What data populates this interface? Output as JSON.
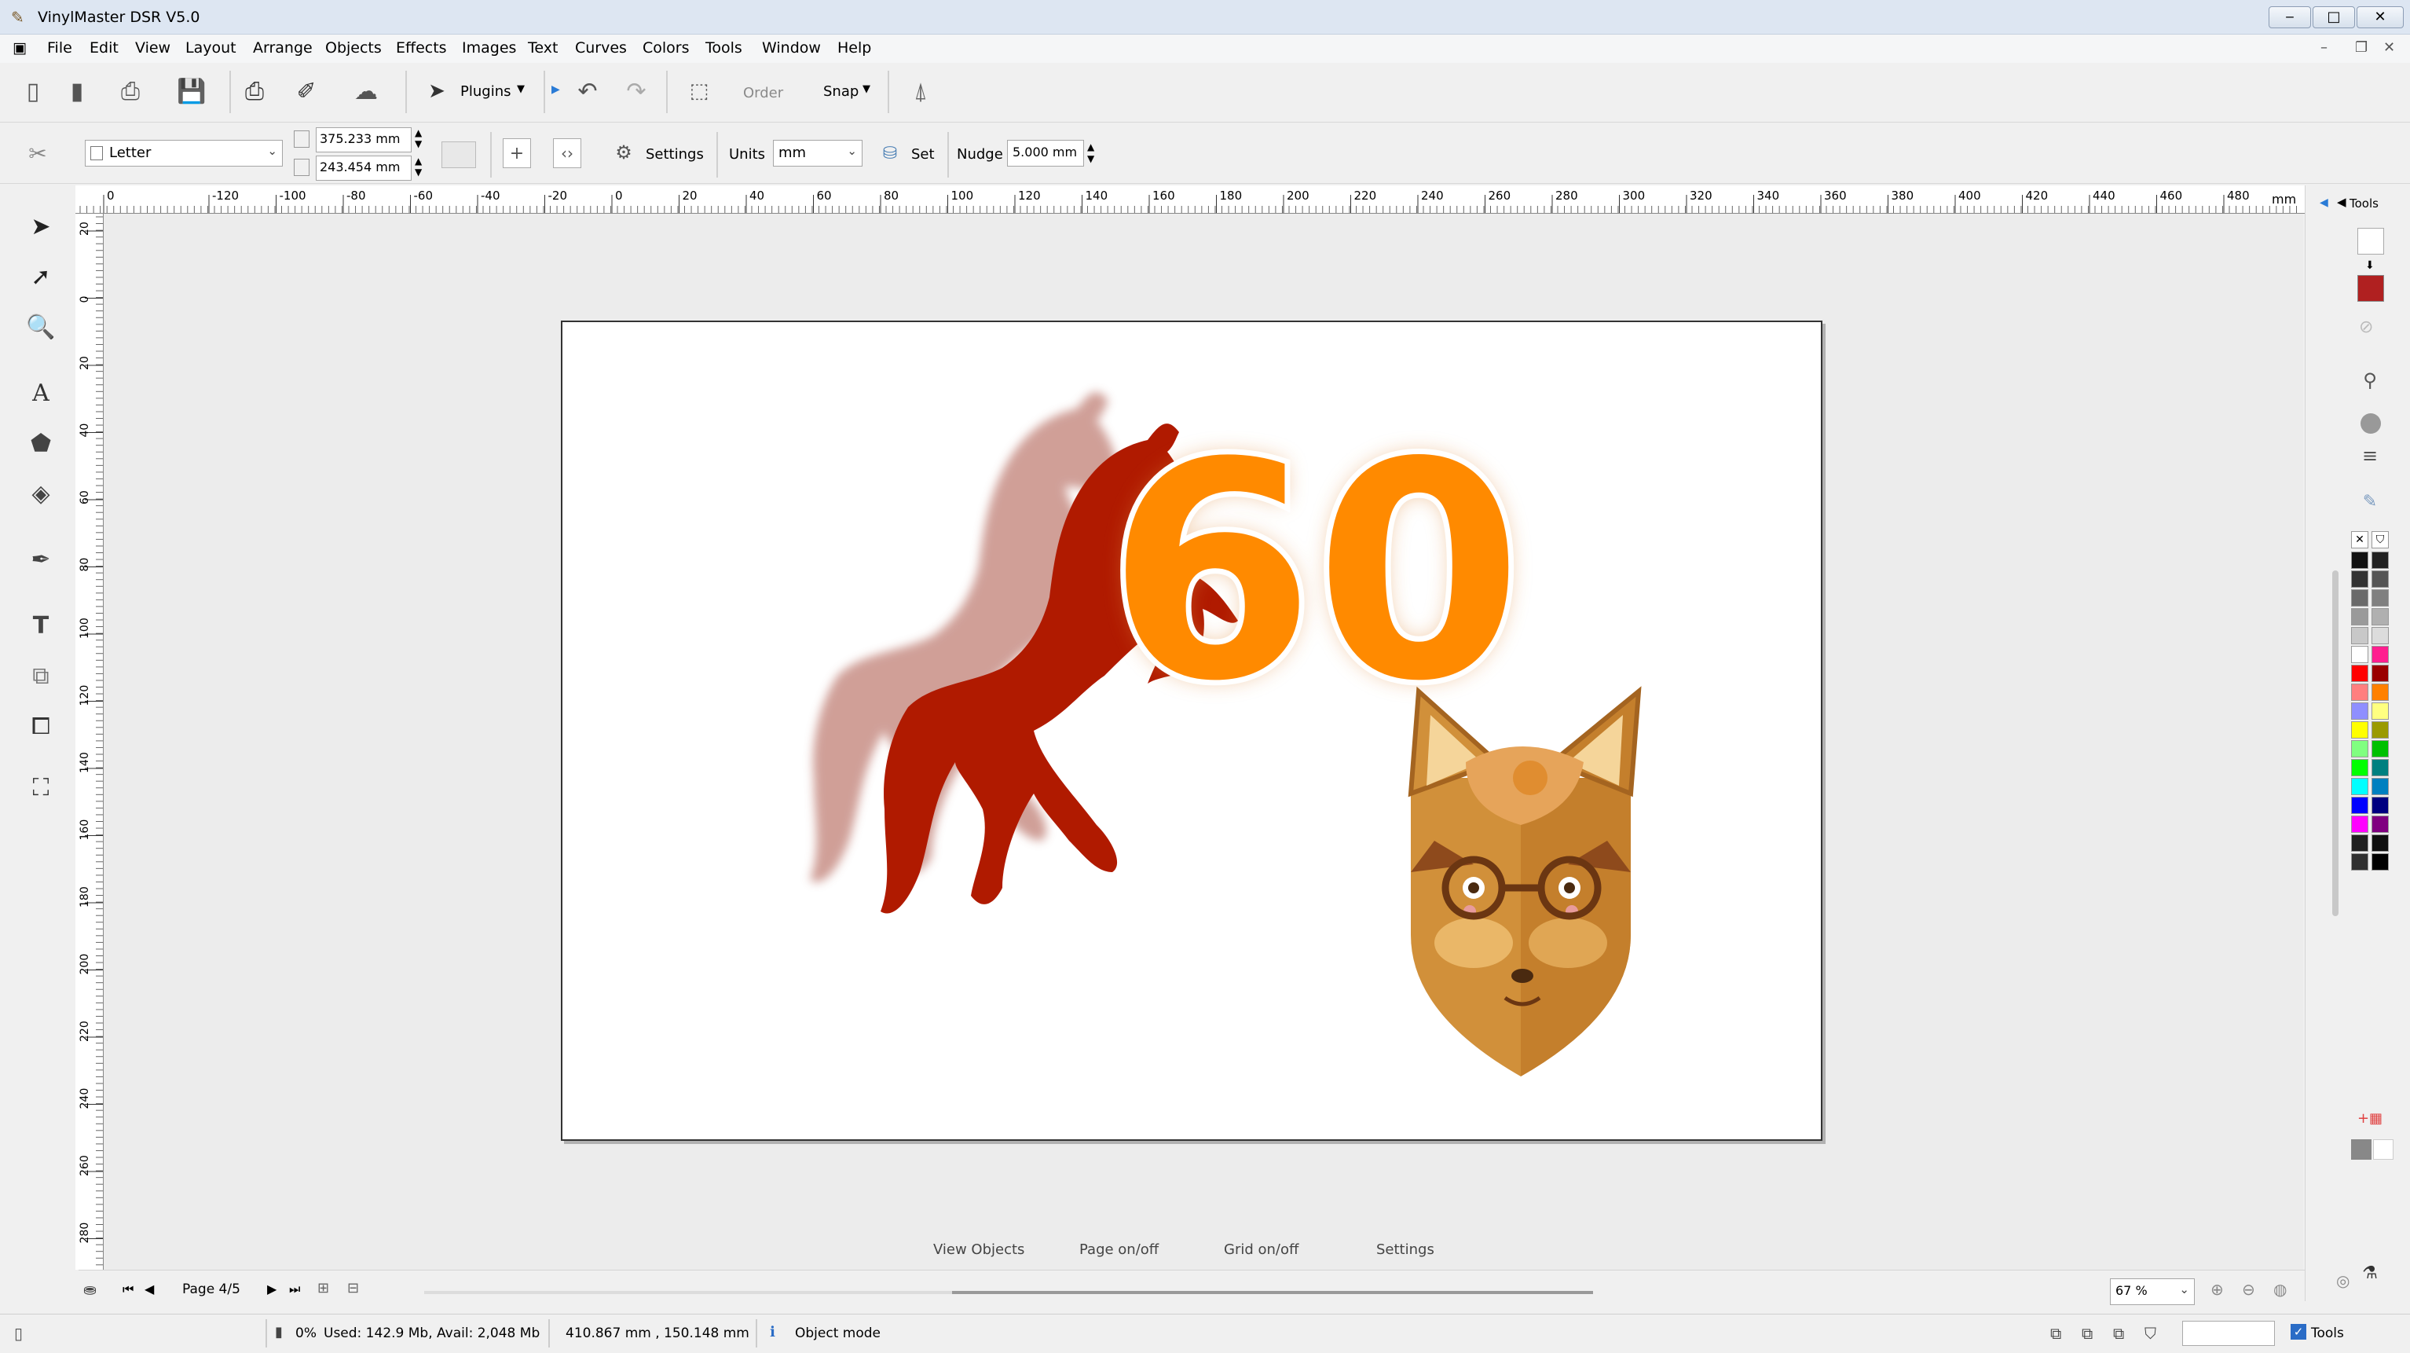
{
  "window": {
    "title": "VinylMaster DSR V5.0"
  },
  "menu": [
    "File",
    "Edit",
    "View",
    "Layout",
    "Arrange",
    "Objects",
    "Effects",
    "Images",
    "Text",
    "Curves",
    "Colors",
    "Tools",
    "Window",
    "Help"
  ],
  "toolbar": {
    "plugins_label": "Plugins",
    "order_label": "Order",
    "snap_label": "Snap",
    "page_size": "Letter",
    "width": "375.233 mm",
    "height": "243.454 mm",
    "settings_label": "Settings",
    "units_label": "Units",
    "units_value": "mm",
    "set_label": "Set",
    "nudge_label": "Nudge",
    "nudge_value": "5.000 mm"
  },
  "ruler": {
    "h_ticks": [
      "0",
      "-120",
      "-100",
      "-80",
      "-60",
      "-40",
      "-20",
      "0",
      "20",
      "40",
      "60",
      "80",
      "100",
      "120",
      "140",
      "160",
      "180",
      "200",
      "220",
      "240",
      "260",
      "280",
      "300",
      "320",
      "340",
      "360",
      "380",
      "400",
      "420",
      "440",
      "460",
      "480"
    ],
    "h_unit": "mm",
    "v_ticks": [
      "20",
      "0",
      "20",
      "40",
      "60",
      "80",
      "100",
      "120",
      "140",
      "160",
      "180",
      "200",
      "220",
      "240",
      "260",
      "280"
    ]
  },
  "artwork": {
    "number_text": "60",
    "horse_color": "#b01a00",
    "number_color": "#ff8a00"
  },
  "bottom_links": [
    "View Objects",
    "Page on/off",
    "Grid on/off",
    "Settings"
  ],
  "pager": {
    "label": "Page 4/5"
  },
  "zoom": "67 %",
  "tools_tab": "Tools",
  "status": {
    "percent": "0%",
    "memory": "Used: 142.9 Mb, Avail: 2,048 Mb",
    "coords": "410.867 mm , 150.148 mm",
    "mode": "Object mode",
    "tools_check": "Tools"
  },
  "palette_colors": [
    "#111111",
    "#222222",
    "#333333",
    "#555555",
    "#6a6a6a",
    "#808080",
    "#9a9a9a",
    "#b0b0b0",
    "#c8c8c8",
    "#dcdcdc",
    "#ffffff",
    "#ff1f8f",
    "#ff0000",
    "#9a0000",
    "#ff7f7f",
    "#ff8000",
    "#8f8fff",
    "#ffff80",
    "#ffff00",
    "#9a9a00",
    "#80ff80",
    "#00c000",
    "#00ff00",
    "#008080",
    "#00ffff",
    "#0080c0",
    "#0000ff",
    "#000080",
    "#ff00ff",
    "#800080",
    "#202020",
    "#101010",
    "#303030",
    "#000000"
  ]
}
